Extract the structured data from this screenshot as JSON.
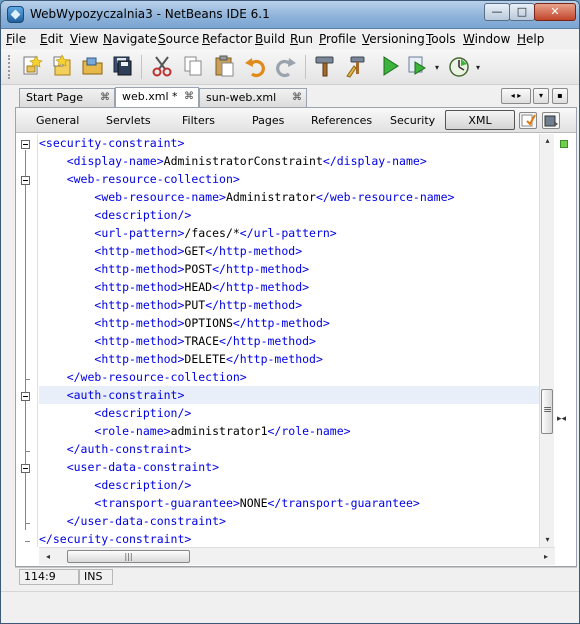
{
  "window": {
    "title": "WebWypozyczalnia3 - NetBeans IDE 6.1",
    "min_label": "—",
    "max_label": "□",
    "close_label": "✕"
  },
  "menu": [
    "File",
    "Edit",
    "View",
    "Navigate",
    "Source",
    "Refactor",
    "Build",
    "Run",
    "Profile",
    "Versioning",
    "Tools",
    "Window",
    "Help"
  ],
  "toolbar": {
    "icons": [
      "new-project-icon",
      "new-file-icon",
      "open-project-icon",
      "save-all-icon",
      "cut-icon",
      "copy-icon",
      "paste-icon",
      "undo-icon",
      "redo-icon",
      "build-icon",
      "clean-build-icon",
      "run-icon",
      "debug-icon",
      "profile-icon"
    ],
    "dropdown_arrow": "▾"
  },
  "tabs": [
    {
      "label": "Start Page",
      "close": "⌘",
      "active": false
    },
    {
      "label": "web.xml *",
      "close": "⌘",
      "active": true
    },
    {
      "label": "sun-web.xml",
      "close": "⌘",
      "active": false
    }
  ],
  "tab_nav": "◂ ▸",
  "tab_menu": "▾",
  "tab_restore": "▪",
  "subtabs": [
    "General",
    "Servlets",
    "Filters",
    "Pages",
    "References",
    "Security",
    "XML"
  ],
  "active_subtab": "XML",
  "code_lines": [
    {
      "indent": "",
      "parts": [
        {
          "t": "tag",
          "v": "<security-constraint>"
        }
      ]
    },
    {
      "indent": "    ",
      "parts": [
        {
          "t": "tag",
          "v": "<display-name>"
        },
        {
          "t": "text",
          "v": "AdministratorConstraint"
        },
        {
          "t": "tag",
          "v": "</display-name>"
        }
      ]
    },
    {
      "indent": "    ",
      "parts": [
        {
          "t": "tag",
          "v": "<web-resource-collection>"
        }
      ]
    },
    {
      "indent": "        ",
      "parts": [
        {
          "t": "tag",
          "v": "<web-resource-name>"
        },
        {
          "t": "text",
          "v": "Administrator"
        },
        {
          "t": "tag",
          "v": "</web-resource-name>"
        }
      ]
    },
    {
      "indent": "        ",
      "parts": [
        {
          "t": "tag",
          "v": "<description/>"
        }
      ]
    },
    {
      "indent": "        ",
      "parts": [
        {
          "t": "tag",
          "v": "<url-pattern>"
        },
        {
          "t": "text",
          "v": "/faces/*"
        },
        {
          "t": "tag",
          "v": "</url-pattern>"
        }
      ]
    },
    {
      "indent": "        ",
      "parts": [
        {
          "t": "tag",
          "v": "<http-method>"
        },
        {
          "t": "text",
          "v": "GET"
        },
        {
          "t": "tag",
          "v": "</http-method>"
        }
      ]
    },
    {
      "indent": "        ",
      "parts": [
        {
          "t": "tag",
          "v": "<http-method>"
        },
        {
          "t": "text",
          "v": "POST"
        },
        {
          "t": "tag",
          "v": "</http-method>"
        }
      ]
    },
    {
      "indent": "        ",
      "parts": [
        {
          "t": "tag",
          "v": "<http-method>"
        },
        {
          "t": "text",
          "v": "HEAD"
        },
        {
          "t": "tag",
          "v": "</http-method>"
        }
      ]
    },
    {
      "indent": "        ",
      "parts": [
        {
          "t": "tag",
          "v": "<http-method>"
        },
        {
          "t": "text",
          "v": "PUT"
        },
        {
          "t": "tag",
          "v": "</http-method>"
        }
      ]
    },
    {
      "indent": "        ",
      "parts": [
        {
          "t": "tag",
          "v": "<http-method>"
        },
        {
          "t": "text",
          "v": "OPTIONS"
        },
        {
          "t": "tag",
          "v": "</http-method>"
        }
      ]
    },
    {
      "indent": "        ",
      "parts": [
        {
          "t": "tag",
          "v": "<http-method>"
        },
        {
          "t": "text",
          "v": "TRACE"
        },
        {
          "t": "tag",
          "v": "</http-method>"
        }
      ]
    },
    {
      "indent": "        ",
      "parts": [
        {
          "t": "tag",
          "v": "<http-method>"
        },
        {
          "t": "text",
          "v": "DELETE"
        },
        {
          "t": "tag",
          "v": "</http-method>"
        }
      ]
    },
    {
      "indent": "    ",
      "parts": [
        {
          "t": "tag",
          "v": "</web-resource-collection>"
        }
      ]
    },
    {
      "indent": "    ",
      "parts": [
        {
          "t": "tag",
          "v": "<auth-constraint>"
        }
      ],
      "current": true
    },
    {
      "indent": "        ",
      "parts": [
        {
          "t": "tag",
          "v": "<description/>"
        }
      ]
    },
    {
      "indent": "        ",
      "parts": [
        {
          "t": "tag",
          "v": "<role-name>"
        },
        {
          "t": "text",
          "v": "administrator1"
        },
        {
          "t": "tag",
          "v": "</role-name>"
        }
      ]
    },
    {
      "indent": "    ",
      "parts": [
        {
          "t": "tag",
          "v": "</auth-constraint>"
        }
      ]
    },
    {
      "indent": "    ",
      "parts": [
        {
          "t": "tag",
          "v": "<user-data-constraint>"
        }
      ]
    },
    {
      "indent": "        ",
      "parts": [
        {
          "t": "tag",
          "v": "<description/>"
        }
      ]
    },
    {
      "indent": "        ",
      "parts": [
        {
          "t": "tag",
          "v": "<transport-guarantee>"
        },
        {
          "t": "text",
          "v": "NONE"
        },
        {
          "t": "tag",
          "v": "</transport-guarantee>"
        }
      ]
    },
    {
      "indent": "    ",
      "parts": [
        {
          "t": "tag",
          "v": "</user-data-constraint>"
        }
      ]
    },
    {
      "indent": "",
      "parts": [
        {
          "t": "tag",
          "v": "</security-constraint>"
        }
      ]
    }
  ],
  "scrollbar": {
    "up": "▴",
    "down": "▾",
    "left": "◂",
    "right": "▸",
    "grip": "|||",
    "stripe_mark": "▸◂"
  },
  "status": {
    "position": "114:9",
    "mode": "INS"
  }
}
